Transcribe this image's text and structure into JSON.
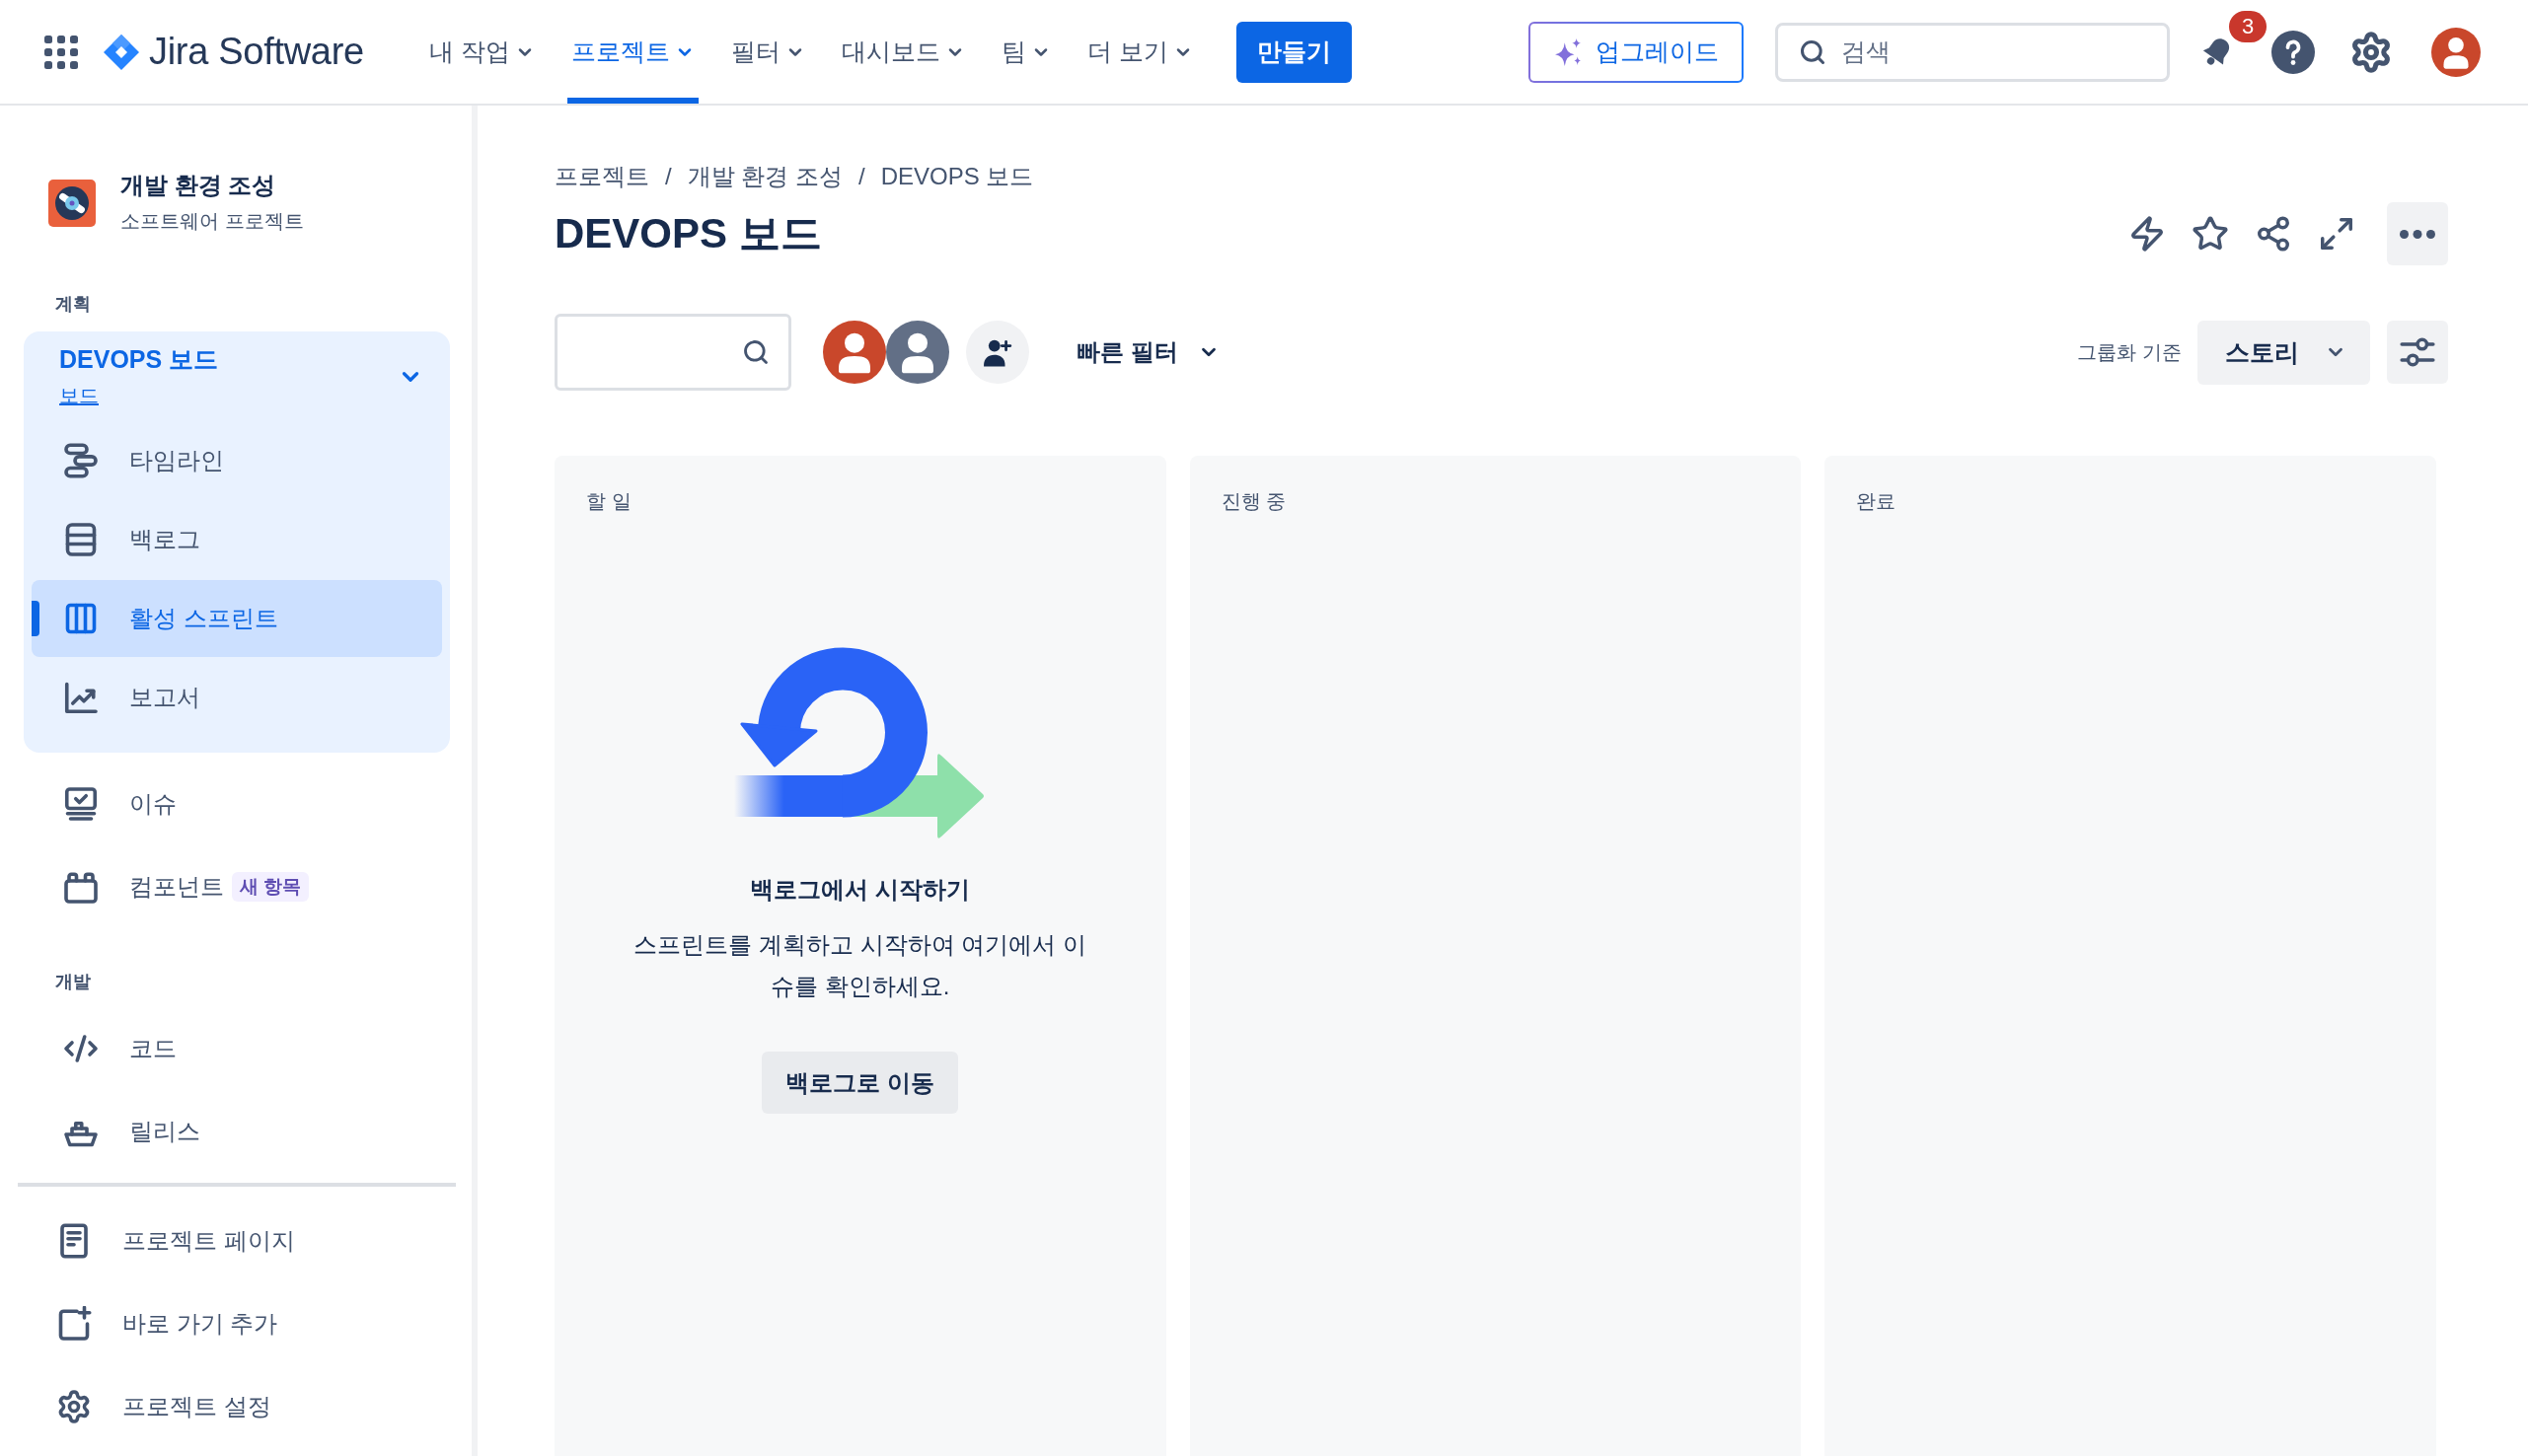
{
  "top_nav": {
    "product_name": "Jira Software",
    "menus": [
      {
        "label": "내 작업",
        "selected": false
      },
      {
        "label": "프로젝트",
        "selected": true
      },
      {
        "label": "필터",
        "selected": false
      },
      {
        "label": "대시보드",
        "selected": false
      },
      {
        "label": "팀",
        "selected": false
      },
      {
        "label": "더 보기",
        "selected": false
      }
    ],
    "create_button": "만들기",
    "upgrade_button": "업그레이드",
    "search": {
      "placeholder": "검색"
    },
    "notification_count": "3"
  },
  "sidebar": {
    "project": {
      "name": "개발 환경 조성",
      "type": "소프트웨어 프로젝트"
    },
    "sections": [
      {
        "heading": "계획",
        "items": [
          {
            "kind": "group",
            "label": "DEVOPS 보드",
            "sublabel": "보드",
            "expanded": true,
            "children": [
              {
                "label": "타임라인",
                "selected": false
              },
              {
                "label": "백로그",
                "selected": false
              },
              {
                "label": "활성 스프린트",
                "selected": true
              },
              {
                "label": "보고서",
                "selected": false
              }
            ]
          },
          {
            "kind": "link",
            "label": "이슈",
            "selected": false
          },
          {
            "kind": "link",
            "label": "컴포넌트",
            "badge": "새 항목",
            "selected": false
          }
        ]
      },
      {
        "heading": "개발",
        "items": [
          {
            "kind": "link",
            "label": "코드",
            "selected": false
          },
          {
            "kind": "link",
            "label": "릴리스",
            "selected": false
          }
        ]
      }
    ],
    "footer_items": [
      {
        "label": "프로젝트 페이지",
        "selected": false
      },
      {
        "label": "바로 가기 추가",
        "selected": false
      },
      {
        "label": "프로젝트 설정",
        "selected": false
      }
    ]
  },
  "board": {
    "breadcrumbs": {
      "items": [
        "프로젝트",
        "개발 환경 조성",
        "DEVOPS 보드"
      ],
      "separators": [
        "/",
        "/"
      ]
    },
    "title": "DEVOPS 보드",
    "avatars": [
      {
        "color": "#c9472b"
      },
      {
        "color": "#626f86"
      }
    ],
    "quick_filter": "빠른 필터",
    "group_by": {
      "label": "그룹화 기준",
      "value": "스토리"
    },
    "columns": [
      {
        "title": "할 일",
        "empty_state": {
          "title": "백로그에서 시작하기",
          "description": "스프린트를 계획하고 시작하여 여기에서 이슈를 확인하세요.",
          "button": "백로그로 이동"
        }
      },
      {
        "title": "진행 중"
      },
      {
        "title": "완료"
      }
    ]
  }
}
